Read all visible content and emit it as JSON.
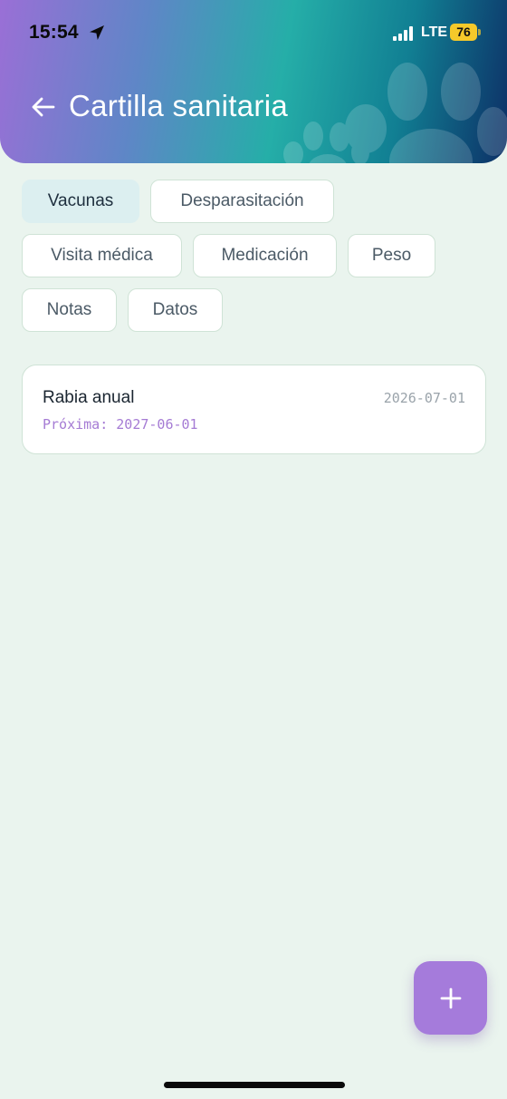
{
  "status_bar": {
    "time": "15:54",
    "network": "LTE",
    "battery": "76"
  },
  "header": {
    "title": "Cartilla sanitaria",
    "back_icon": "arrow-left-icon"
  },
  "tabs": [
    {
      "label": "Vacunas",
      "active": true
    },
    {
      "label": "Desparasitación",
      "active": false
    },
    {
      "label": "Visita médica",
      "active": false
    },
    {
      "label": "Medicación",
      "active": false
    },
    {
      "label": "Peso",
      "active": false
    },
    {
      "label": "Notas",
      "active": false
    },
    {
      "label": "Datos",
      "active": false
    }
  ],
  "records": [
    {
      "title": "Rabia anual",
      "date": "2026-07-01",
      "next": "Próxima: 2027-06-01"
    }
  ],
  "fab": {
    "icon": "plus-icon"
  },
  "colors": {
    "background": "#eaf4ee",
    "accent": "#a57bdb",
    "active_chip": "#dceff0",
    "next_date_text": "#a57bd4"
  }
}
